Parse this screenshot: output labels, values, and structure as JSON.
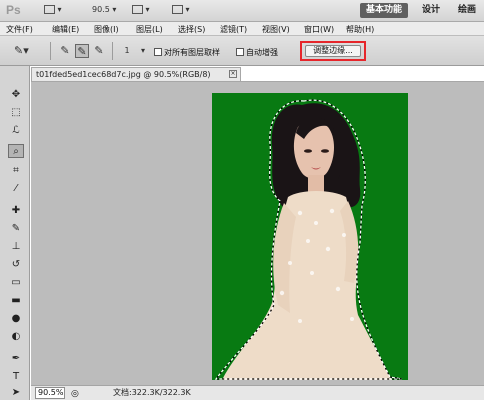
{
  "appbar": {
    "logo": "Ps",
    "zoom_value": "90.5",
    "workspaces": [
      "基本功能",
      "设计",
      "绘画"
    ]
  },
  "menu": [
    "文件(F)",
    "编辑(E)",
    "图像(I)",
    "图层(L)",
    "选择(S)",
    "滤镜(T)",
    "视图(V)",
    "窗口(W)",
    "帮助(H)"
  ],
  "options": {
    "brush_size": "1",
    "sample_all_layers": "对所有图层取样",
    "auto_enhance": "自动增强",
    "refine_edge": "调整边缘..."
  },
  "document": {
    "tab_title": "t01fded5ed1cec68d7c.jpg @ 90.5%(RGB/8)",
    "close_glyph": "×",
    "bg_color": "#087a12"
  },
  "status": {
    "zoom": "90.5%",
    "doc_info": "文档:322.3K/322.3K"
  },
  "icons": {
    "move": "✥",
    "marquee": "⬚",
    "lasso": "ℒ",
    "quick-select": "⌕",
    "crop": "⌗",
    "eyedropper": "⁄",
    "healing": "✚",
    "brush": "✎",
    "stamp": "⊥",
    "history": "↺",
    "eraser": "▭",
    "gradient": "▬",
    "blur": "●",
    "dodge": "◐",
    "pen": "✒",
    "type": "T",
    "path-select": "➤"
  }
}
